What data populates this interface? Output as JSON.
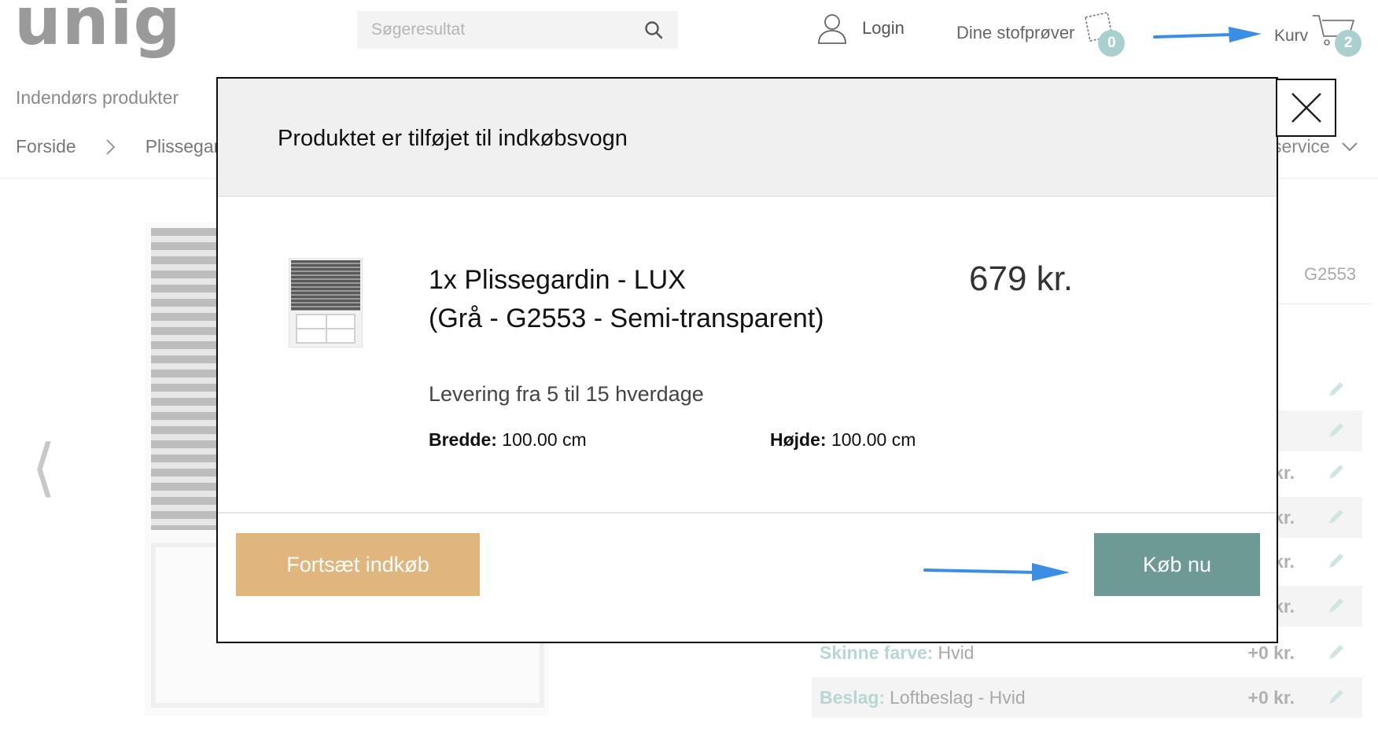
{
  "header": {
    "logo_text": "unig",
    "search_placeholder": "Søgeresultat",
    "login_label": "Login",
    "samples_label": "Dine stofprøver",
    "samples_count": "0",
    "cart_label": "Kurv",
    "cart_count": "2",
    "badge_color": "#a9d0cf"
  },
  "subnav": {
    "label": "Indendørs produkter",
    "breadcrumb": [
      "Forside",
      "Plissegar"
    ],
    "service_label": "service"
  },
  "background": {
    "sku": "G2553",
    "options": [
      {
        "label": "",
        "value": "",
        "price": "kr."
      },
      {
        "label": "",
        "value": "",
        "price": "kr."
      },
      {
        "label": "",
        "value": "",
        "price": "kr."
      },
      {
        "label": "",
        "value": "",
        "price": "kr."
      },
      {
        "label": "Skinne farve:",
        "value": "Hvid",
        "price": "+0 kr."
      },
      {
        "label": "Beslag:",
        "value": "Loftbeslag - Hvid",
        "price": "+0 kr."
      }
    ]
  },
  "modal": {
    "title": "Produktet er tilføjet til indkøbsvogn",
    "product_line1": "1x Plissegardin - LUX",
    "product_line2": "(Grå - G2553 - Semi-transparent)",
    "price": "679 kr.",
    "delivery": "Levering fra 5 til 15 hverdage",
    "width_label": "Bredde:",
    "width_value": "100.00 cm",
    "height_label": "Højde:",
    "height_value": "100.00 cm",
    "continue_label": "Fortsæt indkøb",
    "buy_label": "Køb nu",
    "continue_color": "#e0b57e",
    "buy_color": "#6e9a95"
  },
  "annotations": {
    "arrow_color": "#3a8ee6"
  }
}
